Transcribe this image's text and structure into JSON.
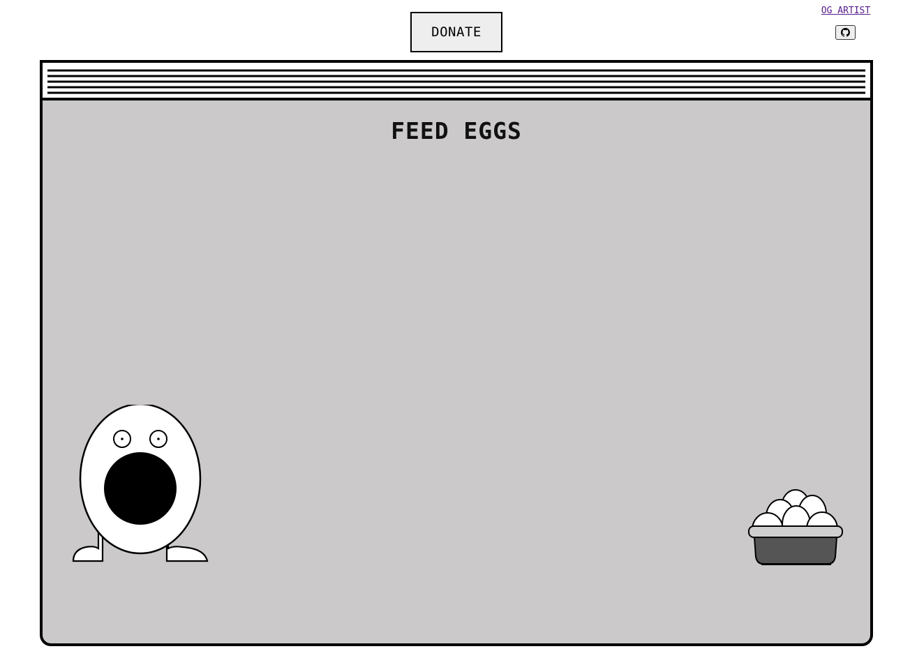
{
  "header": {
    "donate_label": "DONATE",
    "og_artist_label": "OG ARTIST",
    "github_icon": "github-icon"
  },
  "game": {
    "title": "FEED EGGS",
    "creature_icon": "egg-creature-icon",
    "basket_icon": "egg-basket-icon"
  },
  "colors": {
    "window_background": "#cbc9ca",
    "outline": "#000000",
    "basket_fill": "#555555",
    "link": "#551a8b"
  }
}
